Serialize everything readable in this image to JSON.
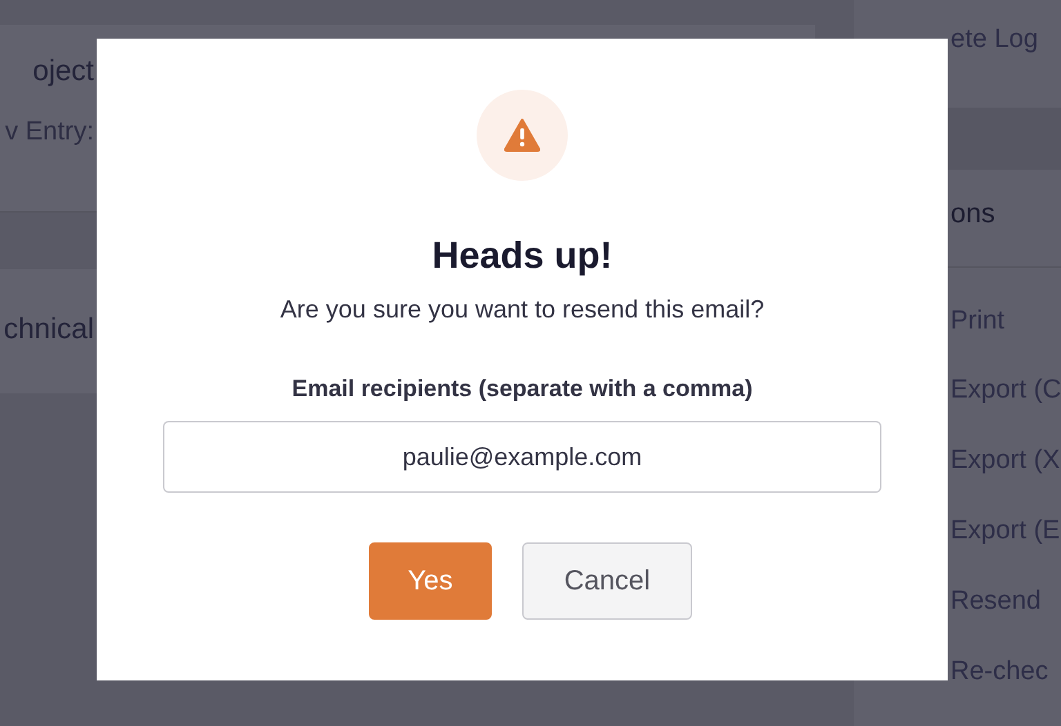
{
  "background": {
    "left_texts": [
      {
        "text": "oject",
        "kind": "title"
      },
      {
        "text": "v Entry:",
        "kind": "label"
      },
      {
        "text": "chnical",
        "kind": "title"
      }
    ],
    "right_texts": [
      {
        "text": "ete Log",
        "kind": "item"
      },
      {
        "text": "ons",
        "kind": "heading"
      },
      {
        "text": "Print",
        "kind": "item"
      },
      {
        "text": "Export (C",
        "kind": "item"
      },
      {
        "text": "Export (X",
        "kind": "item"
      },
      {
        "text": "Export (E",
        "kind": "item"
      },
      {
        "text": "Resend",
        "kind": "item"
      },
      {
        "text": "Re-chec",
        "kind": "item"
      }
    ]
  },
  "dialog": {
    "title": "Heads up!",
    "message": "Are you sure you want to resend this email?",
    "field_label": "Email recipients (separate with a comma)",
    "field_value": "paulie@example.com",
    "buttons": [
      {
        "label": "Yes",
        "kind": "primary"
      },
      {
        "label": "Cancel",
        "kind": "secondary"
      }
    ]
  }
}
